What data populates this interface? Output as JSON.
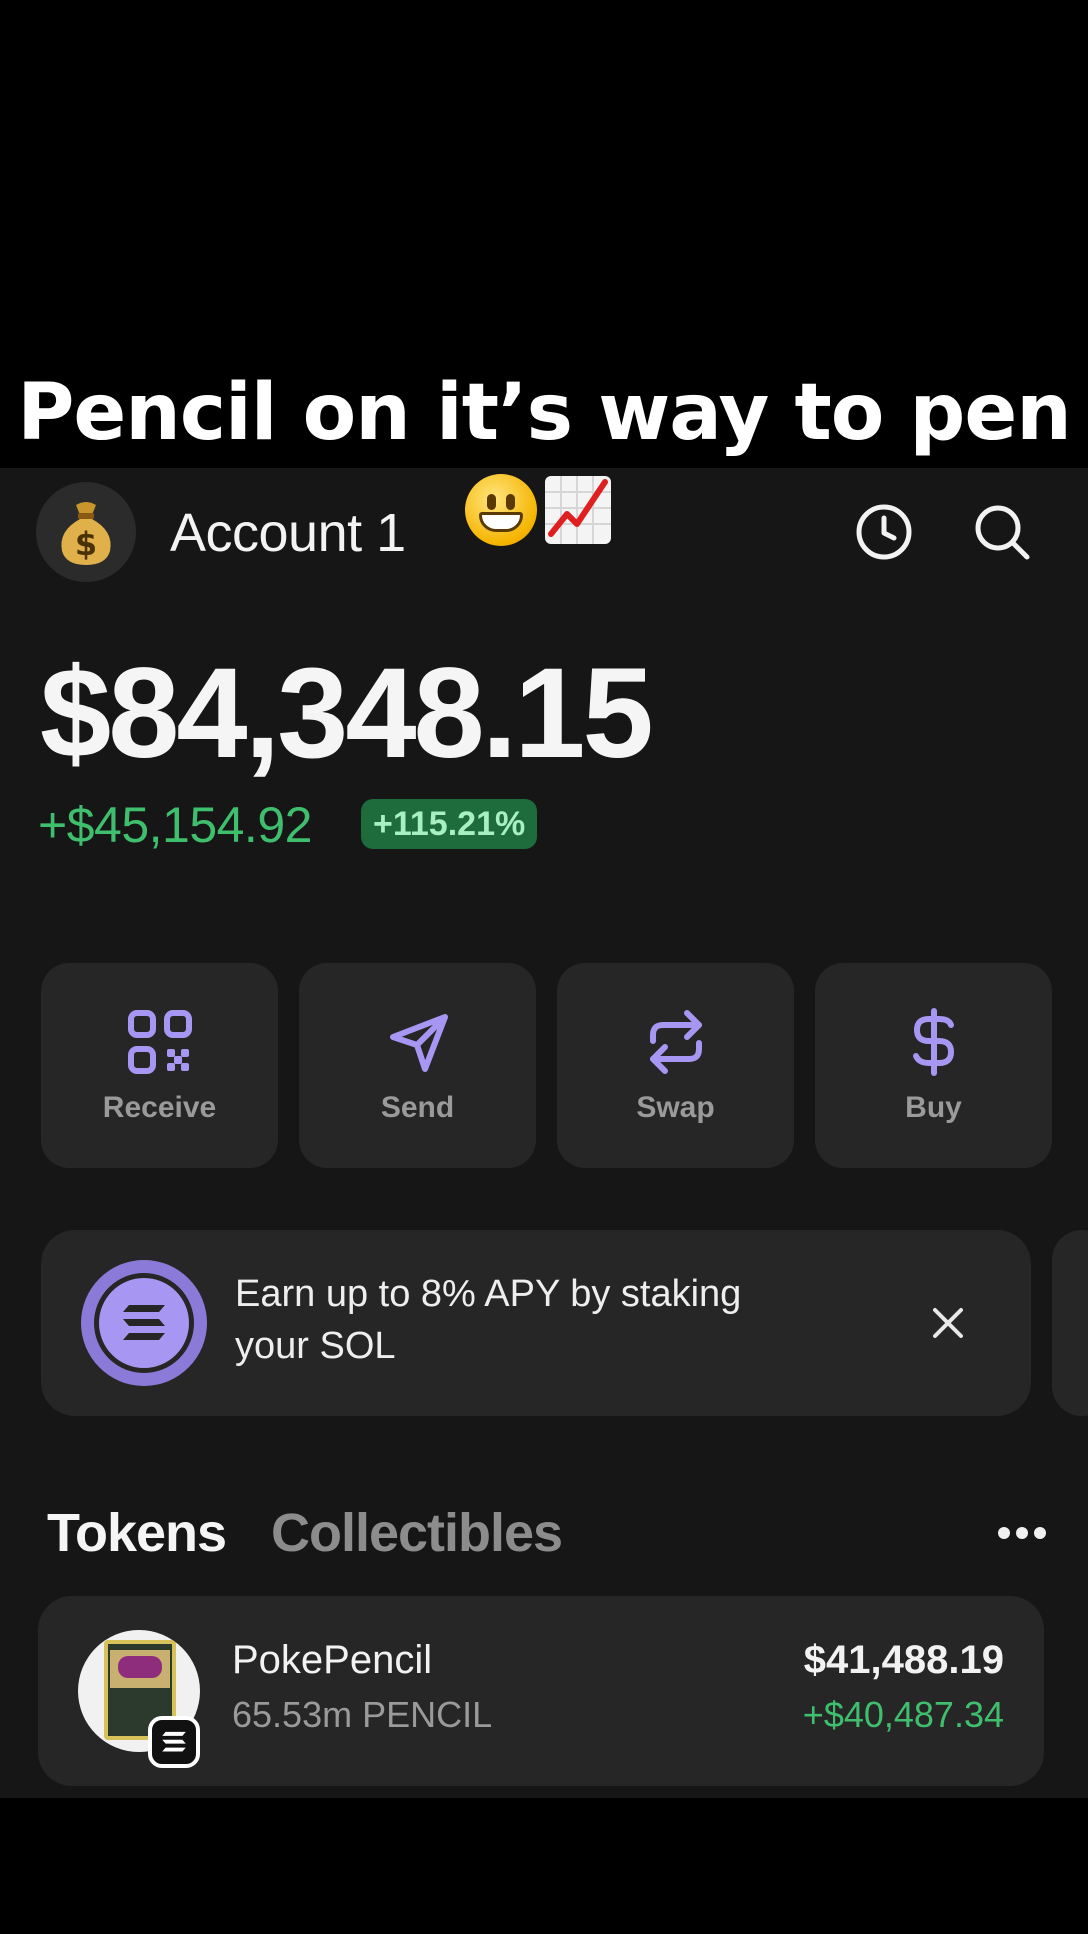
{
  "overlay": {
    "caption": "Pencil on it’s way to pen",
    "emojis": [
      "grinning-face",
      "chart-increasing"
    ]
  },
  "header": {
    "account_name": "Account 1",
    "avatar_icon": "money-bag-icon",
    "history_icon": "clock-icon",
    "search_icon": "search-icon"
  },
  "portfolio": {
    "balance": "$84,348.15",
    "change_value": "+$45,154.92",
    "change_percent": "+115.21%"
  },
  "actions": [
    {
      "label": "Receive",
      "icon": "qr-code-icon"
    },
    {
      "label": "Send",
      "icon": "send-icon"
    },
    {
      "label": "Swap",
      "icon": "swap-icon"
    },
    {
      "label": "Buy",
      "icon": "dollar-icon"
    }
  ],
  "promo": {
    "text_line1": "Earn up to 8% APY by staking",
    "text_line2": "your SOL",
    "icon": "solana-icon",
    "close_icon": "close-icon"
  },
  "tabs": {
    "tokens": "Tokens",
    "collectibles": "Collectibles",
    "more_icon": "more-icon"
  },
  "tokens": [
    {
      "name": "PokePencil",
      "amount": "65.53m PENCIL",
      "value": "$41,488.19",
      "change": "+$40,487.34"
    }
  ],
  "colors": {
    "background": "#161616",
    "card": "#262626",
    "positive": "#3fbf6e",
    "accent": "#a796f2"
  }
}
